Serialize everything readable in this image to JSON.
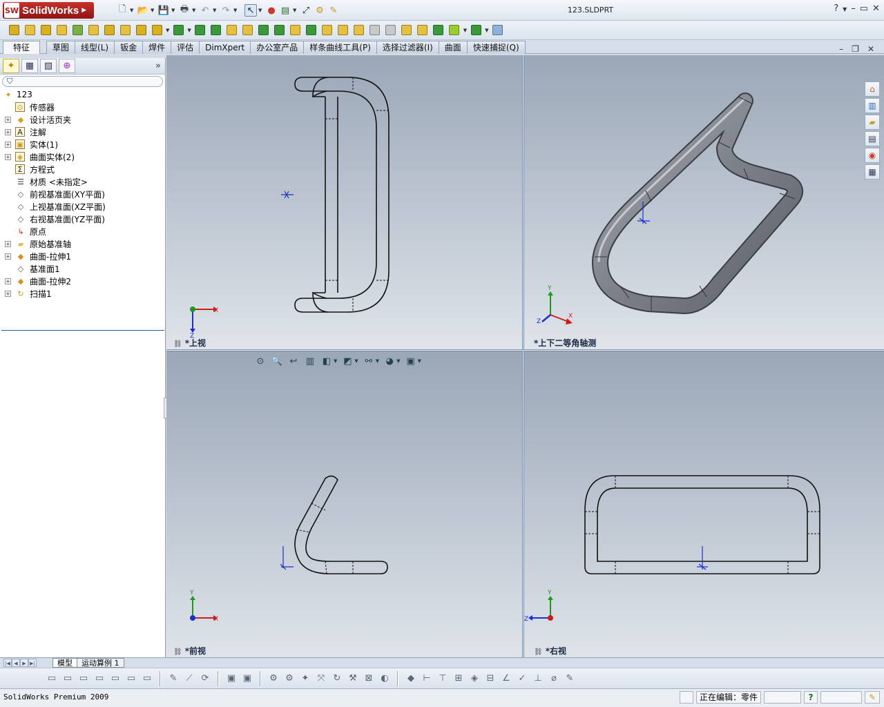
{
  "app": {
    "logo_text": "SolidWorks",
    "logo_badge": "SW",
    "document_title": "123.SLDPRT"
  },
  "quick_access": [
    {
      "icon": "new-document-icon",
      "glyph": "🗋"
    },
    {
      "icon": "open-folder-icon",
      "glyph": "📂"
    },
    {
      "icon": "save-icon",
      "glyph": "💾"
    },
    {
      "icon": "print-icon",
      "glyph": "🖶"
    },
    {
      "icon": "undo-icon",
      "glyph": "↶"
    },
    {
      "icon": "redo-icon",
      "glyph": "↷"
    },
    {
      "icon": "select-arrow-icon",
      "glyph": "↖"
    },
    {
      "icon": "rebuild-traffic-light-icon",
      "glyph": "●"
    },
    {
      "icon": "file-properties-icon",
      "glyph": "▤"
    },
    {
      "icon": "zoom-to-fit-icon",
      "glyph": "⤢"
    },
    {
      "icon": "options-icon",
      "glyph": "⚙"
    },
    {
      "icon": "macro-icon",
      "glyph": "✎"
    }
  ],
  "window_controls": {
    "help": "?",
    "minimize": "–",
    "restore": "▭",
    "close": "✕"
  },
  "command_tabs": [
    "特征",
    "草图",
    "线型(L)",
    "钣金",
    "焊件",
    "评估",
    "DimXpert",
    "办公室产品",
    "样条曲线工具(P)",
    "选择过滤器(I)",
    "曲面",
    "快速捕捉(Q)"
  ],
  "active_tab": "特征",
  "feature_tree": {
    "root": "123",
    "items": [
      {
        "label": "传感器",
        "icon": "sensor-icon",
        "expandable": false
      },
      {
        "label": "设计活页夹",
        "icon": "design-binder-icon",
        "expandable": true
      },
      {
        "label": "注解",
        "icon": "annotations-icon",
        "expandable": true
      },
      {
        "label": "实体(1)",
        "icon": "solid-bodies-icon",
        "expandable": true
      },
      {
        "label": "曲面实体(2)",
        "icon": "surface-bodies-icon",
        "expandable": true
      },
      {
        "label": "方程式",
        "icon": "equations-icon",
        "expandable": false
      },
      {
        "label": "材质 <未指定>",
        "icon": "material-icon",
        "expandable": false
      },
      {
        "label": "前视基准面(XY平面)",
        "icon": "plane-icon",
        "expandable": false
      },
      {
        "label": "上视基准面(XZ平面)",
        "icon": "plane-icon",
        "expandable": false
      },
      {
        "label": "右视基准面(YZ平面)",
        "icon": "plane-icon",
        "expandable": false
      },
      {
        "label": "原点",
        "icon": "origin-icon",
        "expandable": false
      },
      {
        "label": "原始基准轴",
        "icon": "folder-icon",
        "expandable": true
      },
      {
        "label": "曲面-拉伸1",
        "icon": "surface-extrude-icon",
        "expandable": true
      },
      {
        "label": "基准面1",
        "icon": "plane-icon",
        "expandable": false
      },
      {
        "label": "曲面-拉伸2",
        "icon": "surface-extrude-icon",
        "expandable": true
      },
      {
        "label": "扫描1",
        "icon": "sweep-icon",
        "expandable": true
      }
    ]
  },
  "viewports": {
    "top": {
      "label": "*上视"
    },
    "iso": {
      "label": "*上下二等角轴测"
    },
    "front": {
      "label": "*前视"
    },
    "right": {
      "label": "*右视"
    }
  },
  "triad_labels": {
    "x": "X",
    "y": "Y",
    "z": "Z"
  },
  "sheet_tabs": [
    "模型",
    "运动算例 1"
  ],
  "active_sheet": "模型",
  "status": {
    "product": "SolidWorks Premium 2009",
    "editing": "正在编辑：零件",
    "help_badge": "?"
  },
  "colors": {
    "brand_red": "#b21d1a",
    "wire": "#111111",
    "shaded_tube": "#8a8f98",
    "axis_x": "#d11a1a",
    "axis_y": "#1a9a1a",
    "axis_z": "#1a2fd1",
    "selection_blue": "#2b5fa6"
  }
}
